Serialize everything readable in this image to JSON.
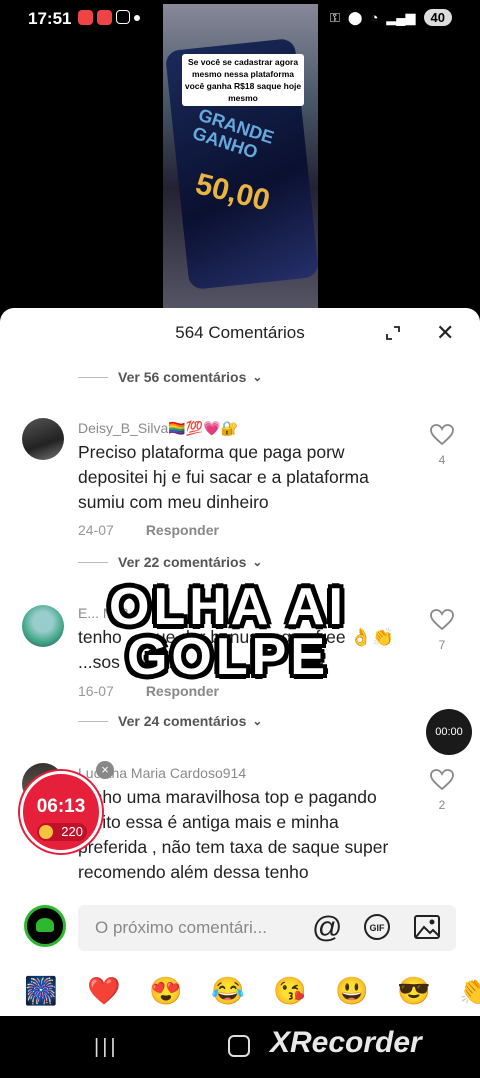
{
  "status_bar": {
    "time": "17:51",
    "battery": "40"
  },
  "video": {
    "caption": "Se você se cadastrar agora mesmo nessa plataforma você ganha R$18 saque hoje mesmo",
    "game_text": "GRANDE GANHO",
    "amount": "50,00"
  },
  "sheet": {
    "title": "564 Comentários"
  },
  "replies_links": [
    "Ver 56 comentários",
    "Ver 22 comentários",
    "Ver 24 comentários"
  ],
  "comments": [
    {
      "name": "Deisy_B_Silva🏳️‍🌈💯💗🔐",
      "text": "Preciso plataforma que paga porw depositei hj e fui sacar e a plataforma sumiu com meu dinheiro",
      "date": "24-07",
      "reply_label": "Responder",
      "likes": "4"
    },
    {
      "name": "E... M R...A",
      "text": "tenho ... que dar bonus saque free 👌👏 ...sos de L...V.",
      "date": "16-07",
      "reply_label": "Responder",
      "likes": "7"
    },
    {
      "name": "Luciana Maria Cardoso914",
      "text": "tenho uma maravilhosa top e pagando muito essa é antiga mais e minha preferida , não tem taxa de saque super recomendo além dessa  tenho",
      "likes": "2"
    }
  ],
  "overlay": {
    "line1": "OLHA AI",
    "line2": "GOLPE"
  },
  "timer_button": "00:00",
  "coin_widget": {
    "time": "06:13",
    "points": "220"
  },
  "input": {
    "placeholder": "O próximo comentári..."
  },
  "emojis": [
    "🎆",
    "❤️",
    "😍",
    "😂",
    "😘",
    "😃",
    "😎",
    "👏"
  ],
  "watermark": "XRecorder"
}
